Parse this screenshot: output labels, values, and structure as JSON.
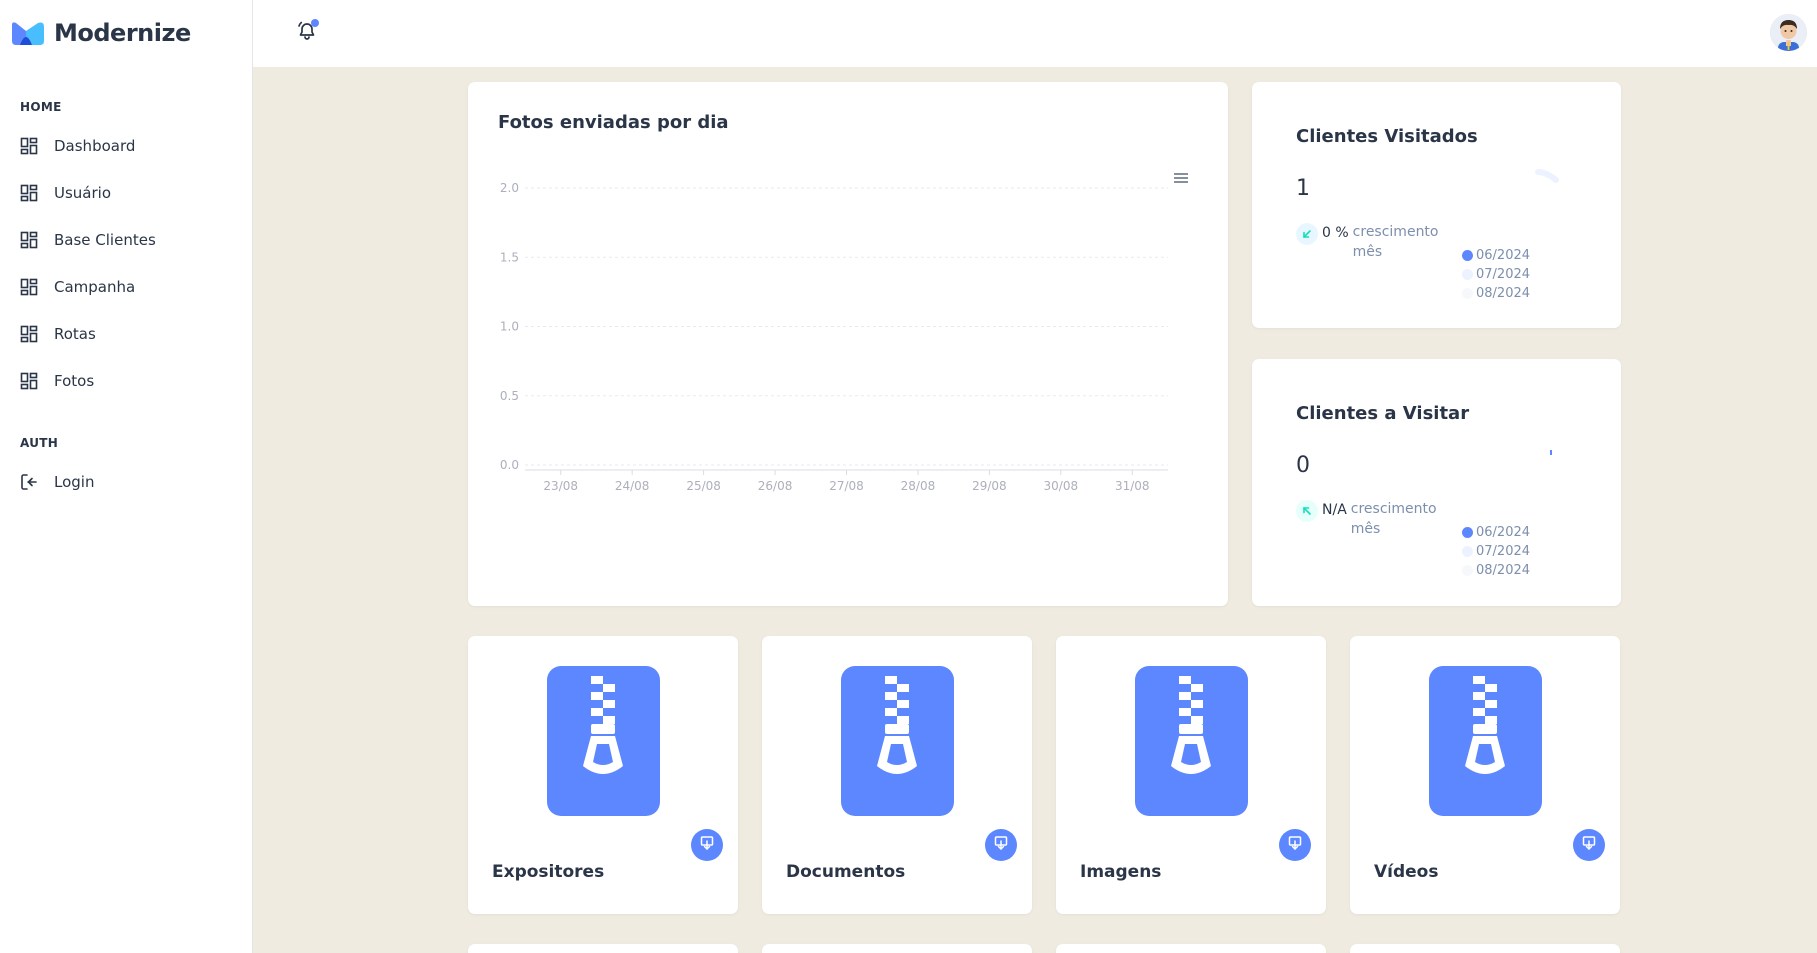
{
  "app": {
    "name": "Modernize",
    "accent": "#5d87ff",
    "background": "#efebe1"
  },
  "sidebar": {
    "sections": [
      {
        "label": "HOME"
      },
      {
        "label": "AUTH"
      }
    ],
    "items": [
      {
        "label": "Dashboard",
        "icon": "layout-dashboard-icon"
      },
      {
        "label": "Usuário",
        "icon": "layout-dashboard-icon"
      },
      {
        "label": "Base Clientes",
        "icon": "layout-dashboard-icon"
      },
      {
        "label": "Campanha",
        "icon": "layout-dashboard-icon"
      },
      {
        "label": "Rotas",
        "icon": "layout-dashboard-icon"
      },
      {
        "label": "Fotos",
        "icon": "layout-dashboard-icon"
      },
      {
        "label": "Login",
        "icon": "login-icon"
      }
    ]
  },
  "header": {
    "notification_icon": "bell-icon",
    "has_unread": true,
    "avatar": "user-avatar"
  },
  "photos_chart": {
    "title": "Fotos enviadas por dia",
    "menu_icon": "hamburger-menu-icon"
  },
  "chart_data": {
    "type": "line",
    "title": "Fotos enviadas por dia",
    "x": [
      "23/08",
      "24/08",
      "25/08",
      "26/08",
      "27/08",
      "28/08",
      "29/08",
      "30/08",
      "31/08"
    ],
    "yticks": [
      "0.0",
      "0.5",
      "1.0",
      "1.5",
      "2.0"
    ],
    "ylim": [
      0,
      2
    ],
    "grid": true,
    "series": [
      {
        "values": [
          0,
          0,
          0,
          0,
          0,
          0,
          0,
          0,
          0
        ]
      }
    ]
  },
  "stats": [
    {
      "title": "Clientes Visitados",
      "value": "1",
      "growth": "0 %",
      "growth_label": "crescimento mês",
      "trend": "down",
      "legend": [
        "06/2024",
        "07/2024",
        "08/2024"
      ]
    },
    {
      "title": "Clientes a Visitar",
      "value": "0",
      "growth": "N/A",
      "growth_label": "crescimento mês",
      "trend": "up",
      "legend": [
        "06/2024",
        "07/2024",
        "08/2024"
      ]
    }
  ],
  "legend_colors": [
    "#5d87ff",
    "#ecf2ff",
    "#f6f8fc"
  ],
  "files": [
    {
      "name": "Expositores",
      "icon": "zip-file-icon"
    },
    {
      "name": "Documentos",
      "icon": "zip-file-icon"
    },
    {
      "name": "Imagens",
      "icon": "zip-file-icon"
    },
    {
      "name": "Vídeos",
      "icon": "zip-file-icon"
    }
  ]
}
